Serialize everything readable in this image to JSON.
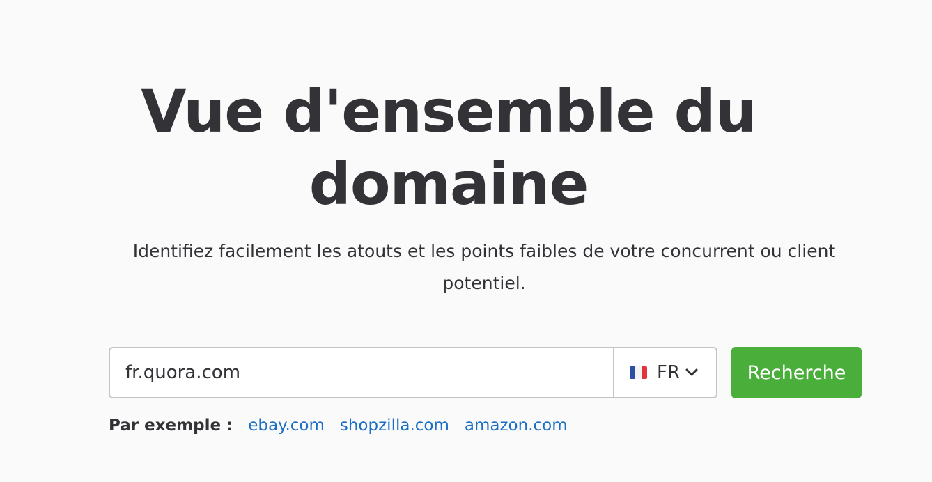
{
  "hero": {
    "title_line1": "Vue d'ensemble du",
    "title_line2": "domaine",
    "subtitle_line1": "Identifiez facilement les atouts et les points faibles de votre concurrent ou client",
    "subtitle_line2": "potentiel."
  },
  "search": {
    "domain_value": "fr.quora.com",
    "database": {
      "flag_icon": "france-flag-icon",
      "label": "FR",
      "chevron_icon": "chevron-down-icon"
    },
    "button_label": "Recherche"
  },
  "examples": {
    "label": "Par exemple :",
    "links": [
      "ebay.com",
      "shopzilla.com",
      "amazon.com"
    ]
  },
  "colors": {
    "background": "#fafafb",
    "text": "#333337",
    "accent_button": "#4aaf3a",
    "link": "#1a6fc4",
    "border": "#c4c4c8"
  }
}
